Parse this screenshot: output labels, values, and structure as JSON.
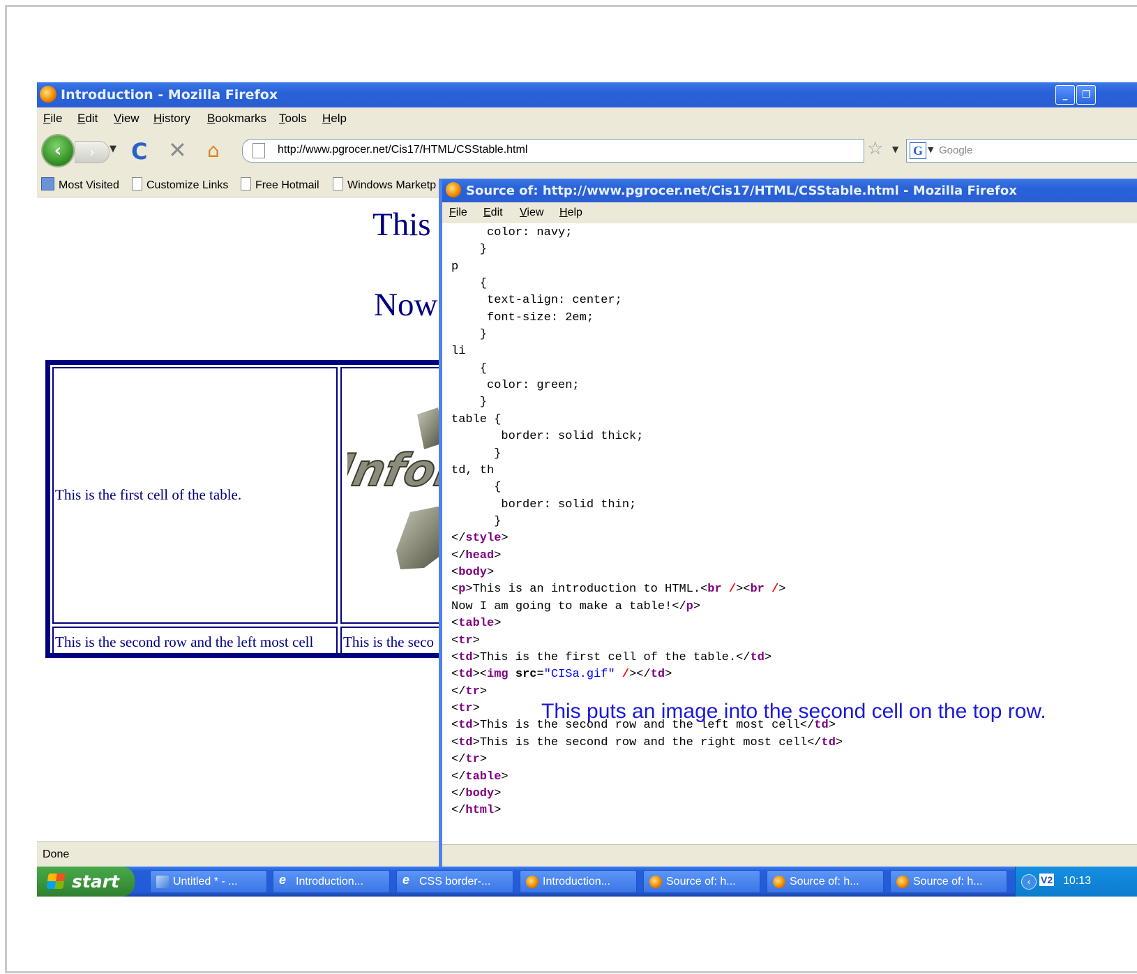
{
  "main_window": {
    "title": "Introduction - Mozilla Firefox",
    "menu": [
      "File",
      "Edit",
      "View",
      "History",
      "Bookmarks",
      "Tools",
      "Help"
    ],
    "url": "http://www.pgrocer.net/Cis17/HTML/CSStable.html",
    "search_placeholder": "Google",
    "bookmarks": [
      "Most Visited",
      "Customize Links",
      "Free Hotmail",
      "Windows Marketp"
    ],
    "status": "Done"
  },
  "page": {
    "heading_line1": "This is",
    "heading_line2": "Now I",
    "table": {
      "cell_1_1": "This is the first cell of the table.",
      "cell_2_1": "This is the second row and the left most cell",
      "cell_2_2": "This is the seco"
    },
    "image_text": "Inform"
  },
  "source_window": {
    "title": "Source of: http://www.pgrocer.net/Cis17/HTML/CSStable.html - Mozilla Firefox",
    "menu": [
      "File",
      "Edit",
      "View",
      "Help"
    ],
    "lines": {
      "l1": "     color: navy;",
      "l2": "    }",
      "l3": "p",
      "l4": "    {",
      "l5": "     text-align: center;",
      "l6": "     font-size: 2em;",
      "l7": "    }",
      "l8": "li",
      "l9": "    {",
      "l10": "     color: green;",
      "l11": "    }",
      "l12": "table {",
      "l13": "       border: solid thick;",
      "l14": "      }",
      "l15": "td, th",
      "l16": "      {",
      "l17": "       border: solid thin;",
      "l18": "      }",
      "t_style_close": "style",
      "t_head_close": "head",
      "t_body_open": "body",
      "p_text": "This is an introduction to HTML.",
      "p_text2": "Now I am going to make a table!",
      "td1_text": "This is the first cell of the table.",
      "img_src": "\"CISa.gif\"",
      "td3_text": "This is the second row and the left most cell",
      "td4_text": "This is the second row and the right most cell"
    }
  },
  "annotation": "This puts an image into the second cell on the top row.",
  "taskbar": {
    "start": "start",
    "tasks": [
      "Untitled * - ...",
      "Introduction...",
      "CSS border-...",
      "Introduction...",
      "Source of: h...",
      "Source of: h...",
      "Source of: h..."
    ],
    "clock": "10:13",
    "tray_badge": "V2"
  },
  "colors": {
    "page_text": "#000080",
    "xp_title_blue": "#2962d8",
    "annotation_blue": "#1a1adb",
    "tag_purple": "#800080"
  }
}
